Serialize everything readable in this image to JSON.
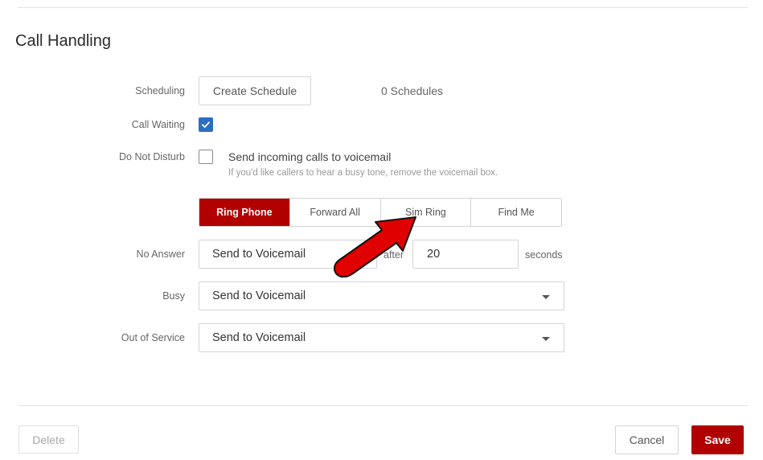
{
  "section": {
    "title": "Call Handling"
  },
  "scheduling": {
    "label": "Scheduling",
    "button_label": "Create Schedule",
    "count_text": "0 Schedules"
  },
  "call_waiting": {
    "label": "Call Waiting",
    "checked": true
  },
  "do_not_disturb": {
    "label": "Do Not Disturb",
    "checked": false,
    "option_label": "Send incoming calls to voicemail",
    "hint": "If you'd like callers to hear a busy tone, remove the voicemail box."
  },
  "ring_mode": {
    "options": [
      "Ring Phone",
      "Forward All",
      "Sim Ring",
      "Find Me"
    ],
    "selected": "Ring Phone"
  },
  "no_answer": {
    "label": "No Answer",
    "value": "Send to Voicemail",
    "after_label": "after",
    "seconds_value": "20",
    "seconds_label": "seconds"
  },
  "busy": {
    "label": "Busy",
    "value": "Send to Voicemail"
  },
  "out_of_service": {
    "label": "Out of Service",
    "value": "Send to Voicemail"
  },
  "footer": {
    "delete_label": "Delete",
    "cancel_label": "Cancel",
    "save_label": "Save"
  },
  "colors": {
    "accent": "#b00000",
    "checkbox": "#2d6ec0",
    "annotation_arrow": "#e10000"
  },
  "annotation": {
    "icon": "red-pointer-arrow-icon"
  }
}
